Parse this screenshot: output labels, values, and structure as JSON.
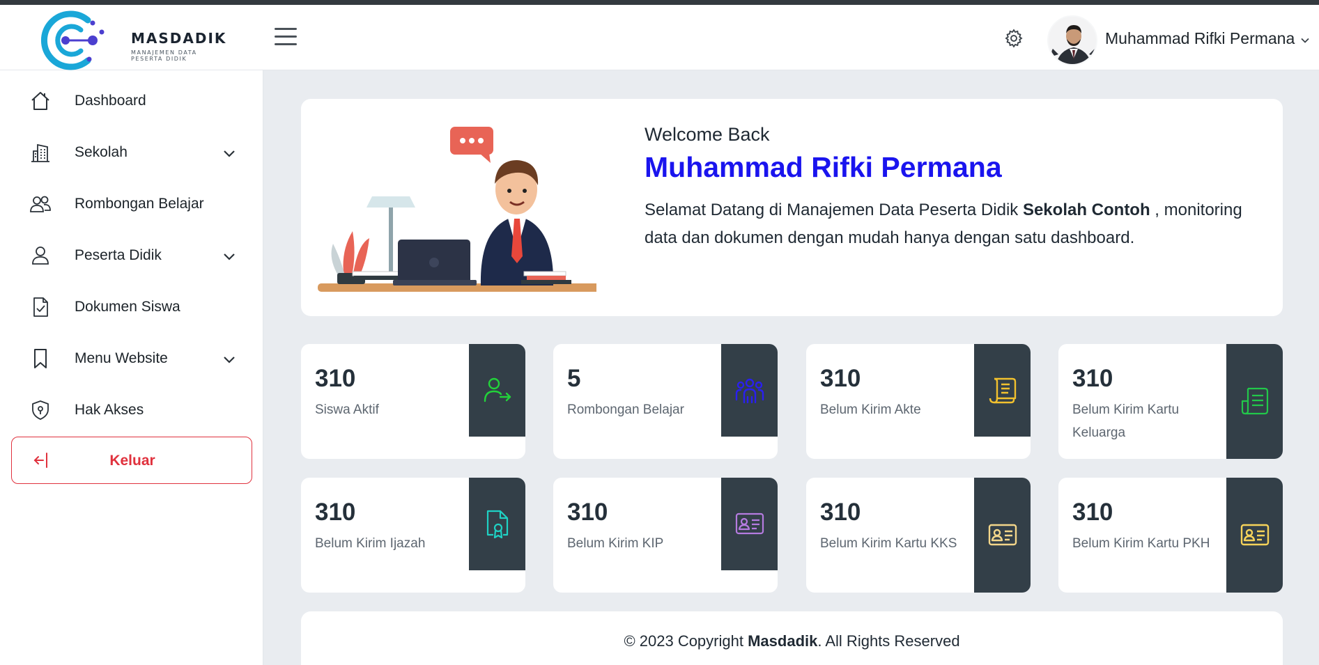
{
  "brand": {
    "name": "MASDADIK",
    "tagline": "MANAJEMEN DATA PESERTA DIDIK"
  },
  "header": {
    "user_name": "Muhammad Rifki Permana"
  },
  "sidebar": {
    "items": [
      {
        "label": "Dashboard",
        "icon": "home-icon",
        "has_submenu": false
      },
      {
        "label": "Sekolah",
        "icon": "building-icon",
        "has_submenu": true
      },
      {
        "label": "Rombongan Belajar",
        "icon": "users-icon",
        "has_submenu": false
      },
      {
        "label": "Peserta Didik",
        "icon": "user-icon",
        "has_submenu": true
      },
      {
        "label": "Dokumen Siswa",
        "icon": "document-check-icon",
        "has_submenu": false
      },
      {
        "label": "Menu Website",
        "icon": "bookmark-icon",
        "has_submenu": true
      },
      {
        "label": "Hak Akses",
        "icon": "shield-icon",
        "has_submenu": false
      }
    ],
    "logout_label": "Keluar"
  },
  "welcome": {
    "greeting": "Welcome Back",
    "name": "Muhammad Rifki Permana",
    "text_before": "Selamat Datang di Manajemen Data Peserta Didik ",
    "school": "Sekolah Contoh",
    "text_after": " , monitoring data dan dokumen dengan mudah hanya dengan satu dashboard."
  },
  "stats": [
    {
      "value": "310",
      "label": "Siswa Aktif",
      "icon": "user-arrow-icon",
      "color": "#22d33a"
    },
    {
      "value": "5",
      "label": "Rombongan Belajar",
      "icon": "group-icon",
      "color": "#2a1ff0"
    },
    {
      "value": "310",
      "label": "Belum Kirim Akte",
      "icon": "scroll-icon",
      "color": "#f2c12e"
    },
    {
      "value": "310",
      "label": "Belum Kirim Kartu Keluarga",
      "icon": "file-lines-icon",
      "color": "#22c84a"
    },
    {
      "value": "310",
      "label": "Belum Kirim Ijazah",
      "icon": "certificate-icon",
      "color": "#1fd1c4"
    },
    {
      "value": "310",
      "label": "Belum Kirim KIP",
      "icon": "id-card-icon",
      "color": "#b57be0"
    },
    {
      "value": "310",
      "label": "Belum Kirim Kartu KKS",
      "icon": "id-card-icon",
      "color": "#f3d68a"
    },
    {
      "value": "310",
      "label": "Belum Kirim Kartu PKH",
      "icon": "id-card-icon",
      "color": "#f7d35a"
    }
  ],
  "footer": {
    "prefix": "© 2023 Copyright ",
    "brand": "Masdadik",
    "suffix": ". All Rights Reserved"
  }
}
